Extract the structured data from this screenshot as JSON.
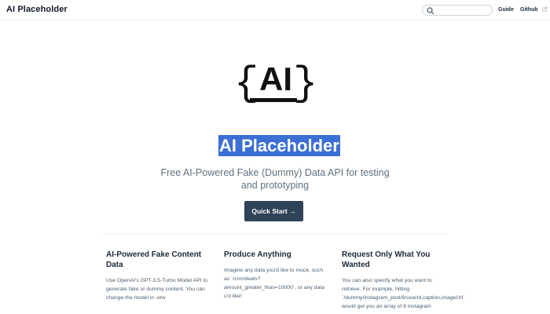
{
  "nav": {
    "brand": "AI Placeholder",
    "search": {
      "placeholder": "",
      "value": ""
    },
    "links": [
      "Guide",
      "Github"
    ]
  },
  "hero": {
    "logo_text": "AI",
    "title": "AI Placeholder",
    "subtitle": "Free AI-Powered Fake (Dummy) Data API for testing and prototyping",
    "cta": "Quick Start →"
  },
  "features": [
    {
      "title": "AI-Powered Fake Content Data",
      "body": "Use OpenAI's GPT-3.5-Turbo Model API to generate fake or dummy content. You can change the model in .env"
    },
    {
      "title": "Produce Anything",
      "body": "Imagine any data you'd like to mock, such as `/crm/deals?amount_greater_than=10000`, or any data u'd like!"
    },
    {
      "title": "Request Only What You Wanted",
      "body": "You can also specify what you want to retrieve. For example, hitting `/dummy/instagram_post/6/userId,caption,imageUrl` would get you an array of 6 instagram"
    }
  ],
  "colors": {
    "accent": "#3b6fd4",
    "button": "#2f4358",
    "subtitle": "#5f7283"
  },
  "icons": [
    "search-icon",
    "external-link-icon",
    "ai-logo-icon"
  ]
}
